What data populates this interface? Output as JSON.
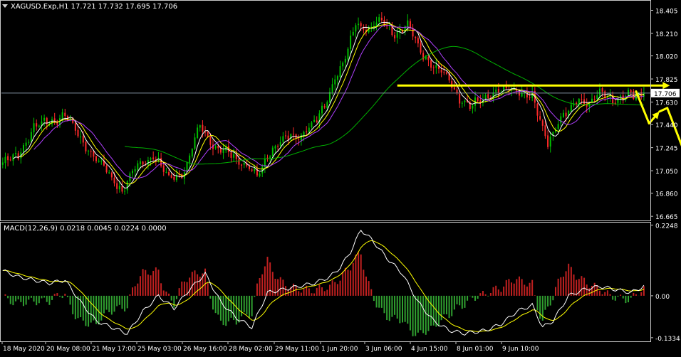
{
  "header": {
    "symbol_line": "XAGUSD.Exp,H1  17.721 17.732 17.695 17.706"
  },
  "colors": {
    "background": "#000000",
    "frame": "#c8c8c8",
    "bull": "#00c000",
    "bear": "#ff2a2a",
    "ma_fast": "#ffffff",
    "ma_mid": "#ffff00",
    "ma_slow_purple": "#b040ff",
    "ma_slow_green": "#00b000",
    "annotation": "#ffff00",
    "price_line": "#8090a0",
    "macd_hist_pos": "#c02020",
    "macd_hist_neg": "#30a030",
    "macd_line": "#ffffff",
    "signal_line": "#ffff00"
  },
  "chart_data": [
    {
      "type": "candlestick",
      "title": "XAGUSD.Exp,H1",
      "ohlc_header": {
        "open": 17.721,
        "high": 17.732,
        "low": 17.695,
        "close": 17.706
      },
      "current_price_label": "17.706",
      "ylim": [
        16.63,
        18.48
      ],
      "y_ticks": [
        "18.405",
        "18.210",
        "18.020",
        "17.825",
        "17.630",
        "17.440",
        "17.245",
        "17.050",
        "16.860",
        "16.665"
      ],
      "x_tick_labels": [
        "18 May 2020",
        "20 May 08:00",
        "21 May 17:00",
        "25 May 03:00",
        "26 May 16:00",
        "28 May 02:00",
        "29 May 11:00",
        "1 Jun 20:00",
        "3 Jun 06:00",
        "4 Jun 15:00",
        "8 Jun 01:00",
        "9 Jun 10:00"
      ],
      "price_anchors": [
        [
          0,
          17.12
        ],
        [
          6,
          17.18
        ],
        [
          12,
          17.42
        ],
        [
          18,
          17.47
        ],
        [
          24,
          17.52
        ],
        [
          30,
          17.32
        ],
        [
          36,
          17.15
        ],
        [
          40,
          17.05
        ],
        [
          46,
          16.88
        ],
        [
          52,
          17.1
        ],
        [
          58,
          17.18
        ],
        [
          64,
          16.98
        ],
        [
          70,
          17.05
        ],
        [
          76,
          17.42
        ],
        [
          82,
          17.25
        ],
        [
          88,
          17.18
        ],
        [
          94,
          17.1
        ],
        [
          98,
          16.99
        ],
        [
          104,
          17.26
        ],
        [
          110,
          17.32
        ],
        [
          116,
          17.38
        ],
        [
          121,
          17.48
        ],
        [
          124,
          17.6
        ],
        [
          128,
          17.85
        ],
        [
          132,
          18.0
        ],
        [
          136,
          18.3
        ],
        [
          141,
          18.25
        ],
        [
          146,
          18.31
        ],
        [
          151,
          18.22
        ],
        [
          156,
          18.28
        ],
        [
          160,
          18.1
        ],
        [
          166,
          17.92
        ],
        [
          172,
          17.82
        ],
        [
          176,
          17.65
        ],
        [
          180,
          17.58
        ],
        [
          186,
          17.68
        ],
        [
          192,
          17.72
        ],
        [
          198,
          17.75
        ],
        [
          204,
          17.66
        ],
        [
          210,
          17.3
        ],
        [
          214,
          17.45
        ],
        [
          218,
          17.55
        ],
        [
          222,
          17.68
        ],
        [
          226,
          17.6
        ],
        [
          230,
          17.72
        ],
        [
          236,
          17.65
        ],
        [
          242,
          17.69
        ],
        [
          247,
          17.72
        ]
      ],
      "moving_averages": [
        {
          "period": 5,
          "color": "#ffffff"
        },
        {
          "period": 8,
          "color": "#ffff00"
        },
        {
          "period": 13,
          "color": "#b040ff"
        },
        {
          "period": 48,
          "color": "#00b000"
        }
      ],
      "annotations": {
        "resistance_arrow": {
          "from": [
            152,
            17.77
          ],
          "to": [
            257,
            17.77
          ],
          "color": "#ffff00"
        },
        "projection_path": [
          [
            244,
            17.72
          ],
          [
            249,
            17.45
          ],
          [
            253,
            17.55
          ],
          [
            256,
            17.58
          ],
          [
            265,
            17.07
          ]
        ]
      }
    },
    {
      "type": "macd",
      "title": "MACD(12,26,9) 0.0218 0.0045 0.0224 0.0000",
      "params": [
        12,
        26,
        9
      ],
      "values_label": {
        "main": 0.0218,
        "signal": 0.0045,
        "histogram": 0.0224,
        "other": 0.0
      },
      "ylim": [
        -0.145,
        0.235
      ],
      "y_ticks": [
        "0.2248",
        "0.00",
        "-0.1334"
      ],
      "macd_anchors": [
        [
          0,
          0.08
        ],
        [
          6,
          0.06
        ],
        [
          12,
          0.05
        ],
        [
          18,
          0.04
        ],
        [
          24,
          0.05
        ],
        [
          30,
          -0.02
        ],
        [
          36,
          -0.08
        ],
        [
          42,
          -0.1
        ],
        [
          48,
          -0.12
        ],
        [
          54,
          -0.05
        ],
        [
          60,
          0.0
        ],
        [
          66,
          -0.04
        ],
        [
          72,
          0.02
        ],
        [
          78,
          0.07
        ],
        [
          84,
          -0.02
        ],
        [
          90,
          -0.07
        ],
        [
          96,
          -0.1
        ],
        [
          102,
          0.01
        ],
        [
          108,
          0.02
        ],
        [
          114,
          0.03
        ],
        [
          120,
          0.04
        ],
        [
          126,
          0.06
        ],
        [
          130,
          0.09
        ],
        [
          134,
          0.14
        ],
        [
          138,
          0.21
        ],
        [
          142,
          0.18
        ],
        [
          148,
          0.12
        ],
        [
          154,
          0.07
        ],
        [
          160,
          -0.02
        ],
        [
          166,
          -0.08
        ],
        [
          172,
          -0.11
        ],
        [
          178,
          -0.12
        ],
        [
          186,
          -0.11
        ],
        [
          192,
          -0.09
        ],
        [
          198,
          -0.05
        ],
        [
          204,
          -0.03
        ],
        [
          208,
          -0.1
        ],
        [
          212,
          -0.08
        ],
        [
          218,
          0.0
        ],
        [
          224,
          0.02
        ],
        [
          230,
          0.03
        ],
        [
          236,
          0.02
        ],
        [
          242,
          0.01
        ],
        [
          247,
          0.03
        ]
      ]
    }
  ]
}
